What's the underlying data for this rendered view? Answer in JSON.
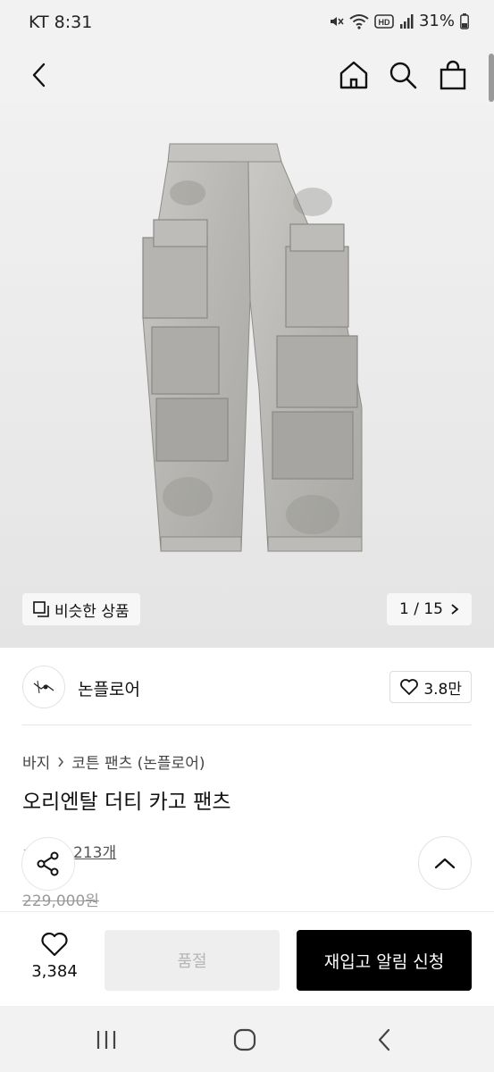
{
  "status": {
    "carrier_time": "KT 8:31",
    "battery": "31%",
    "icons": [
      "mute-icon",
      "wifi-icon",
      "hd-icon",
      "signal-icon",
      "battery-icon"
    ]
  },
  "nav": {
    "icons": [
      "back-icon",
      "home-icon",
      "search-icon",
      "shopping-bag-icon"
    ]
  },
  "hero": {
    "similar_label": "비슷한 상품",
    "page_indicator": "1 / 15"
  },
  "brand": {
    "name": "논플로어",
    "likes": "3.8만"
  },
  "product": {
    "breadcrumb": [
      "바지",
      "코튼 팬츠 (논플로어)"
    ],
    "title": "오리엔탈 더티 카고 팬츠",
    "reviews": "후기 213개",
    "original_price": "229,000원"
  },
  "actions": {
    "wish_count": "3,384",
    "soldout_label": "품절",
    "restock_label": "재입고 알림 신청"
  },
  "colors": {
    "accent_black": "#000000",
    "star": "#f4a300",
    "disabled_bg": "#eeeeee"
  }
}
